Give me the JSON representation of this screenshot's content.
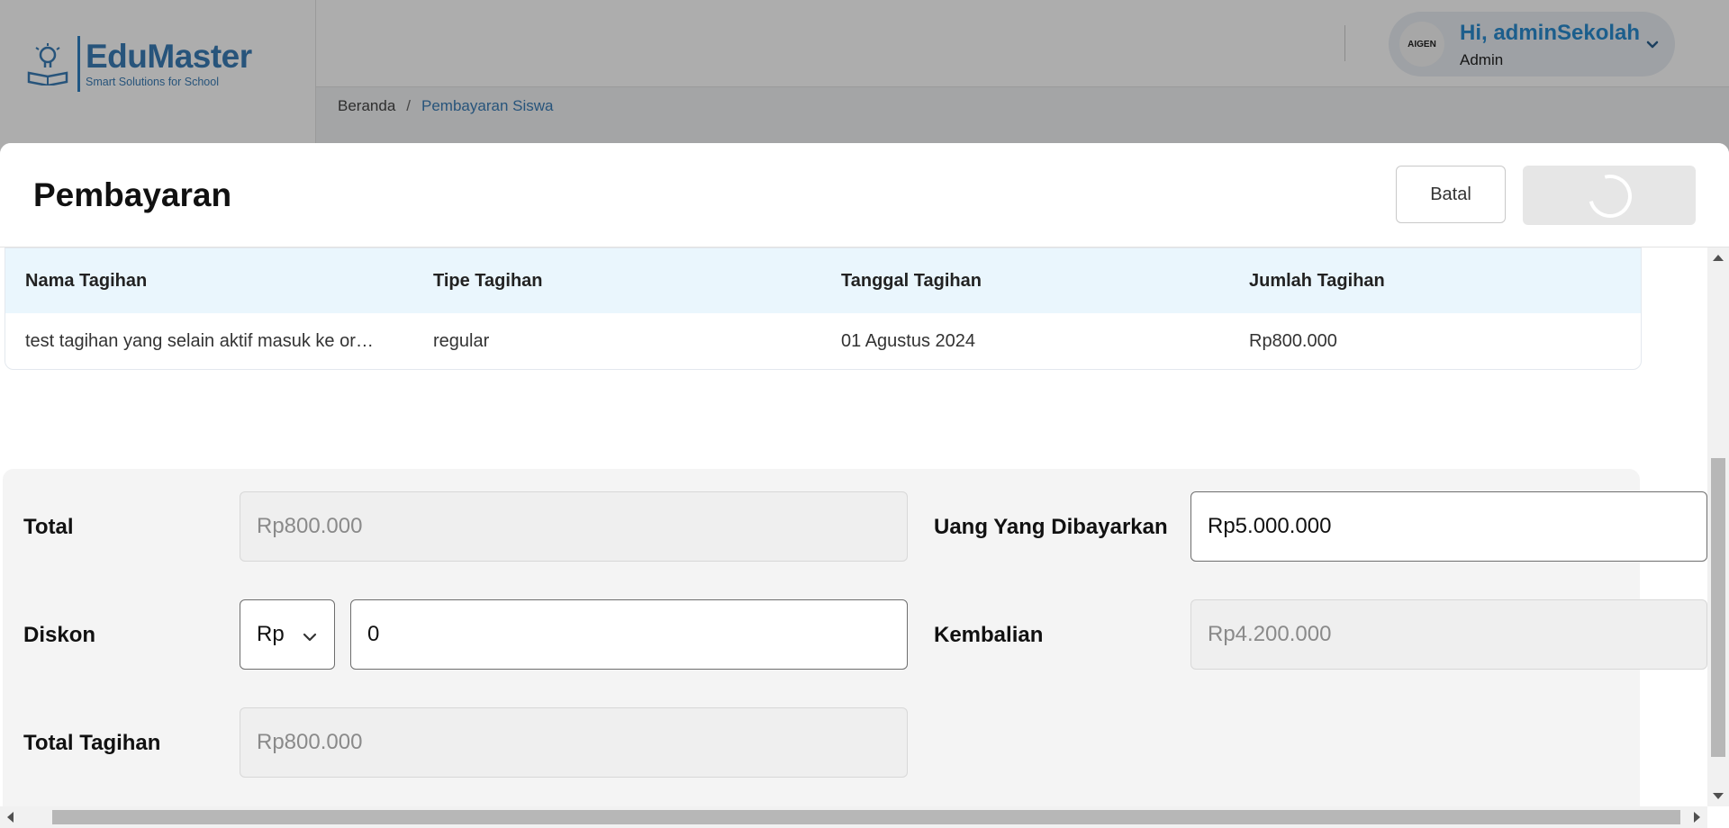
{
  "brand": {
    "name": "EduMaster",
    "tagline": "Smart Solutions for School"
  },
  "header": {
    "greeting": "Hi, adminSekolah",
    "role": "Admin",
    "avatar_text": "AIGEN"
  },
  "breadcrumb": {
    "home": "Beranda",
    "separator": "/",
    "current": "Pembayaran Siswa"
  },
  "modal": {
    "title": "Pembayaran",
    "cancel_label": "Batal",
    "submit_state": "loading"
  },
  "table": {
    "columns": [
      "Nama Tagihan",
      "Tipe Tagihan",
      "Tanggal Tagihan",
      "Jumlah Tagihan"
    ],
    "rows": [
      [
        "test tagihan yang selain aktif masuk ke orthu",
        "regular",
        "01 Agustus 2024",
        "Rp800.000"
      ]
    ]
  },
  "form": {
    "total_label": "Total",
    "total_value": "Rp800.000",
    "paid_label": "Uang Yang Dibayarkan",
    "paid_value": "Rp5.000.000",
    "discount_label": "Diskon",
    "discount_type": "Rp",
    "discount_value": "0",
    "change_label": "Kembalian",
    "change_value": "Rp4.200.000",
    "bill_total_label": "Total Tagihan",
    "bill_total_value": "Rp800.000"
  },
  "colors": {
    "accent": "#3a7cb5",
    "link": "#2a8bcf",
    "table_header_bg": "#eaf6fd"
  }
}
